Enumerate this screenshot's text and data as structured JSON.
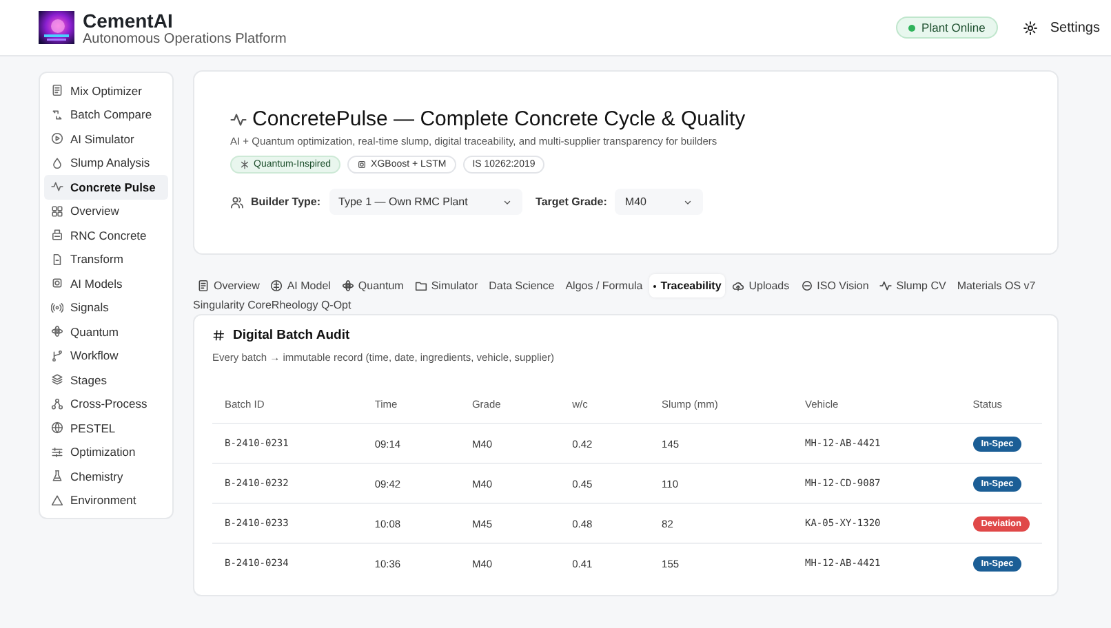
{
  "header": {
    "title": "CementAI",
    "subtitle": "Autonomous Operations Platform",
    "status": {
      "label": "Plant Online",
      "online": true
    },
    "settings": "Settings"
  },
  "sidebar": {
    "items": [
      {
        "label": "Mix Optimizer",
        "selected": false
      },
      {
        "label": "Batch Compare",
        "selected": false
      },
      {
        "label": "AI Simulator",
        "selected": false
      },
      {
        "label": "Slump Analysis",
        "selected": false
      },
      {
        "label": "Concrete Pulse",
        "selected": true
      },
      {
        "label": "Overview",
        "selected": false
      },
      {
        "label": "RNC Concrete",
        "selected": false
      },
      {
        "label": "Transform",
        "selected": false
      },
      {
        "label": "AI Models",
        "selected": false
      },
      {
        "label": "Signals",
        "selected": false
      },
      {
        "label": "Quantum",
        "selected": false
      },
      {
        "label": "Workflow",
        "selected": false
      },
      {
        "label": "Stages",
        "selected": false
      },
      {
        "label": "Cross-Process",
        "selected": false
      },
      {
        "label": "PESTEL",
        "selected": false
      },
      {
        "label": "Optimization",
        "selected": false
      },
      {
        "label": "Chemistry",
        "selected": false
      },
      {
        "label": "Environment",
        "selected": false
      }
    ]
  },
  "hero": {
    "title": "ConcretePulse — Complete Concrete Cycle & Quality",
    "subtitle": "AI + Quantum optimization, real-time slump, digital traceability, and multi-supplier transparency for builders",
    "badges": [
      {
        "label": "Quantum-Inspired",
        "kind": "accent"
      },
      {
        "label": "XGBoost + LSTM",
        "kind": "plain"
      },
      {
        "label": "IS 10262:2019",
        "kind": "plain"
      }
    ],
    "builder_type": {
      "label": "Builder Type:",
      "value": "Type 1 — Own RMC Plant"
    },
    "target_grade": {
      "label": "Target Grade:",
      "value": "M40"
    }
  },
  "tabs": [
    {
      "label": "Overview",
      "selected": false
    },
    {
      "label": "AI Model",
      "selected": false
    },
    {
      "label": "Quantum",
      "selected": false
    },
    {
      "label": "Simulator",
      "selected": false
    },
    {
      "label": "Data Science",
      "selected": false
    },
    {
      "label": "Algos / Formula",
      "selected": false
    },
    {
      "label": "Traceability",
      "selected": true
    },
    {
      "label": "Uploads",
      "selected": false
    },
    {
      "label": "ISO Vision",
      "selected": false
    },
    {
      "label": "Slump CV",
      "selected": false
    },
    {
      "label": "Materials OS v7",
      "selected": false
    },
    {
      "label": "Singularity Core",
      "selected": false
    },
    {
      "label": "Rheology Q-Opt",
      "selected": false
    }
  ],
  "audit": {
    "title": "Digital Batch Audit",
    "description": "Every batch → immutable record (time, date, ingredients, vehicle, supplier)",
    "columns": [
      "Batch ID",
      "Time",
      "Grade",
      "w/c",
      "Slump (mm)",
      "Vehicle",
      "Status"
    ],
    "rows": [
      {
        "batch_id": "B-2410-0231",
        "time": "09:14",
        "grade": "M40",
        "wc": "0.42",
        "slump": "145",
        "vehicle": "MH-12-AB-4421",
        "status": {
          "label": "In-Spec",
          "color": "#1b5e96"
        }
      },
      {
        "batch_id": "B-2410-0232",
        "time": "09:42",
        "grade": "M40",
        "wc": "0.45",
        "slump": "110",
        "vehicle": "MH-12-CD-9087",
        "status": {
          "label": "In-Spec",
          "color": "#1b5e96"
        }
      },
      {
        "batch_id": "B-2410-0233",
        "time": "10:08",
        "grade": "M45",
        "wc": "0.48",
        "slump": "82",
        "vehicle": "KA-05-XY-1320",
        "status": {
          "label": "Deviation",
          "color": "#e04848"
        }
      },
      {
        "batch_id": "B-2410-0234",
        "time": "10:36",
        "grade": "M40",
        "wc": "0.41",
        "slump": "155",
        "vehicle": "MH-12-AB-4421",
        "status": {
          "label": "In-Spec",
          "color": "#1b5e96"
        }
      }
    ]
  }
}
